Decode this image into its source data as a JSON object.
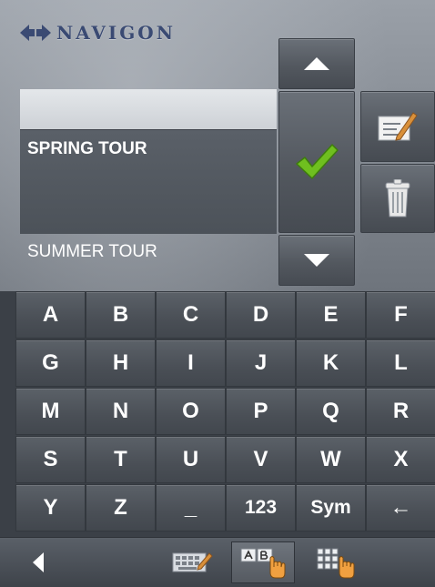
{
  "brand": {
    "name": "NAVIGON"
  },
  "list": {
    "items": [
      {
        "label": ""
      },
      {
        "label": "SPRING TOUR",
        "selected": true
      },
      {
        "label": "SUMMER TOUR"
      }
    ]
  },
  "buttons": {
    "scroll_up": "triangle-up-icon",
    "confirm": "checkmark-icon",
    "scroll_down": "triangle-down-icon",
    "edit": "edit-icon",
    "delete": "trash-icon"
  },
  "keyboard": {
    "rows": [
      [
        "A",
        "B",
        "C",
        "D",
        "E",
        "F"
      ],
      [
        "G",
        "H",
        "I",
        "J",
        "K",
        "L"
      ],
      [
        "M",
        "N",
        "O",
        "P",
        "Q",
        "R"
      ],
      [
        "S",
        "T",
        "U",
        "V",
        "W",
        "X"
      ],
      [
        "Y",
        "Z",
        "_",
        "123",
        "Sym",
        "←"
      ]
    ]
  },
  "bottom_bar": {
    "items": [
      "back-arrow-icon",
      "keyboard-qwerty-icon",
      "keyboard-abc-icon",
      "keypad-icon"
    ],
    "active": "keyboard-abc-icon"
  },
  "colors": {
    "accent_check": "#6fbf1f",
    "brand_blue": "#3a4a73"
  }
}
